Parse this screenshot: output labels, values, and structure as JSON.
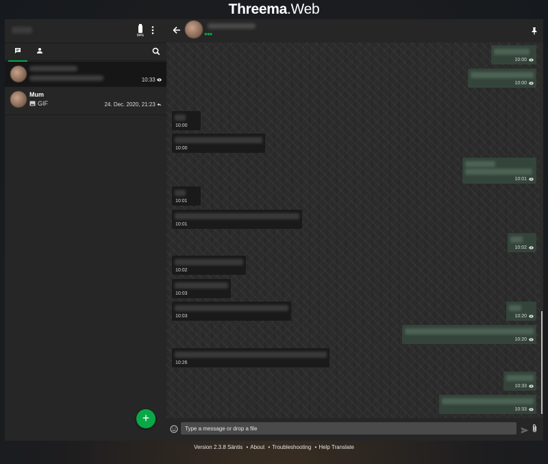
{
  "brand": {
    "name_bold": "Threema",
    "name_light": ".Web"
  },
  "header": {
    "battery_percent": "84%"
  },
  "tabs": [
    {
      "name": "conversations"
    },
    {
      "name": "contacts"
    }
  ],
  "conversations": [
    {
      "name": "",
      "preview": "",
      "time": "10:33",
      "status_icon": "eye-icon"
    },
    {
      "name": "Mum",
      "preview": "GIF",
      "time": "24. Dec. 2020, 21:23",
      "status_icon": "reply-icon"
    }
  ],
  "messages": [
    {
      "dir": "out",
      "time": "10:00"
    },
    {
      "dir": "out",
      "time": "10:00"
    },
    {
      "dir": "in",
      "time": "10:00"
    },
    {
      "dir": "in",
      "time": "10:00"
    },
    {
      "dir": "out",
      "time": "10:01"
    },
    {
      "dir": "in",
      "time": "10:01"
    },
    {
      "dir": "in",
      "time": "10:01"
    },
    {
      "dir": "out",
      "time": "10:02"
    },
    {
      "dir": "in",
      "time": "10:02"
    },
    {
      "dir": "in",
      "time": "10:03"
    },
    {
      "dir": "in",
      "time": "10:03"
    },
    {
      "dir": "out",
      "time": "10:20"
    },
    {
      "dir": "out",
      "time": "10:20"
    },
    {
      "dir": "in",
      "time": "10:26"
    },
    {
      "dir": "out",
      "time": "10:33"
    },
    {
      "dir": "out",
      "time": "10:33"
    }
  ],
  "composer": {
    "placeholder": "Type a message or drop a file"
  },
  "footer": {
    "version": "Version 2.3.8 Säntis",
    "links": [
      "About",
      "Troubleshooting",
      "Help Translate"
    ]
  },
  "colors": {
    "accent": "#09a846",
    "outgoing": "#34443a",
    "incoming": "#1a1a1a"
  }
}
